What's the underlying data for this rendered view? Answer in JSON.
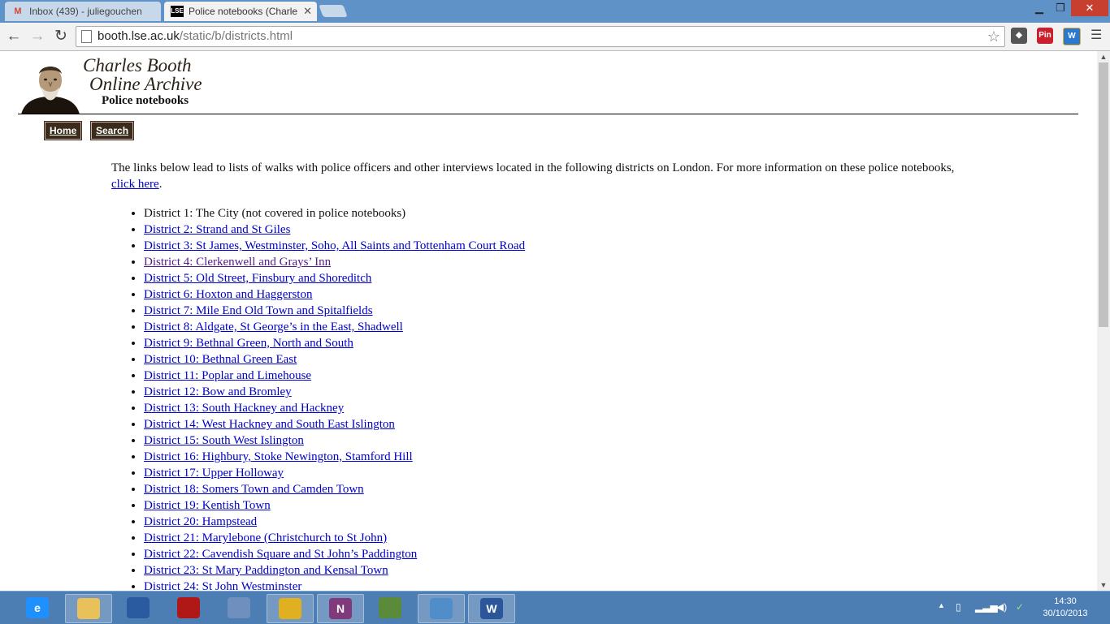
{
  "browser": {
    "tabs": [
      {
        "favicon": "gmail-icon",
        "title": "Inbox (439) - juliegouchen",
        "active": false
      },
      {
        "favicon": "lse-icon",
        "title": "Police notebooks (Charles",
        "active": true
      }
    ],
    "favicon_text": {
      "lse": "LSE",
      "gmail": "M"
    },
    "url_host": "booth.lse.ac.uk",
    "url_path": "/static/b/districts.html",
    "extensions": [
      {
        "name": "evernote-extension-icon",
        "label": ""
      },
      {
        "name": "pinterest-extension-icon",
        "label": "Pin"
      },
      {
        "name": "wikiwand-extension-icon",
        "label": "W"
      }
    ]
  },
  "site": {
    "title_line1": "Charles Booth",
    "title_line2": "Online Archive",
    "subtitle": "Police notebooks",
    "nav": {
      "home": "Home",
      "search": "Search"
    }
  },
  "intro": {
    "text": "The links below lead to lists of walks with police officers and other interviews located in the following districts on London. For more information on these police notebooks, ",
    "link": "click here",
    "end": "."
  },
  "districts": [
    {
      "label": "District 1: The City (not covered in police notebooks)",
      "link": false
    },
    {
      "label": "District 2: Strand and St Giles",
      "link": true
    },
    {
      "label": "District 3: St James, Westminster, Soho, All Saints and Tottenham Court Road",
      "link": true
    },
    {
      "label": "District 4: Clerkenwell and Grays’ Inn",
      "link": true,
      "visited": true
    },
    {
      "label": "District 5: Old Street, Finsbury and Shoreditch",
      "link": true
    },
    {
      "label": "District 6: Hoxton and Haggerston",
      "link": true
    },
    {
      "label": "District 7: Mile End Old Town and Spitalfields",
      "link": true
    },
    {
      "label": "District 8: Aldgate, St George’s in the East, Shadwell",
      "link": true
    },
    {
      "label": "District 9: Bethnal Green, North and South",
      "link": true
    },
    {
      "label": "District 10: Bethnal Green East",
      "link": true
    },
    {
      "label": "District 11: Poplar and Limehouse",
      "link": true
    },
    {
      "label": "District 12: Bow and Bromley",
      "link": true
    },
    {
      "label": "District 13: South Hackney and Hackney",
      "link": true
    },
    {
      "label": "District 14: West Hackney and South East Islington",
      "link": true
    },
    {
      "label": "District 15: South West Islington",
      "link": true
    },
    {
      "label": "District 16: Highbury, Stoke Newington, Stamford Hill",
      "link": true
    },
    {
      "label": "District 17: Upper Holloway",
      "link": true
    },
    {
      "label": "District 18: Somers Town and Camden Town",
      "link": true
    },
    {
      "label": "District 19: Kentish Town",
      "link": true
    },
    {
      "label": "District 20: Hampstead",
      "link": true
    },
    {
      "label": "District 21: Marylebone (Christchurch to St John)",
      "link": true
    },
    {
      "label": "District 22: Cavendish Square and St John’s Paddington",
      "link": true
    },
    {
      "label": "District 23: St Mary Paddington and Kensal Town",
      "link": true
    },
    {
      "label": "District 24: St John Westminster",
      "link": true
    }
  ],
  "taskbar": {
    "apps": [
      {
        "name": "internet-explorer-icon",
        "label": "e",
        "color": "#1e90ff",
        "active": false
      },
      {
        "name": "file-explorer-icon",
        "label": "",
        "color": "#e8c15a",
        "active": true
      },
      {
        "name": "remote-desktop-icon",
        "label": "",
        "color": "#2a5aa0",
        "active": false
      },
      {
        "name": "media-player-icon",
        "label": "",
        "color": "#b01818",
        "active": false
      },
      {
        "name": "messenger-icon",
        "label": "",
        "color": "#6f8fbf",
        "active": false
      },
      {
        "name": "chrome-icon",
        "label": "",
        "color": "#e0b020",
        "active": true
      },
      {
        "name": "onenote-icon",
        "label": "N",
        "color": "#80397b",
        "active": true
      },
      {
        "name": "evernote-icon",
        "label": "",
        "color": "#5a8a3a",
        "active": false
      },
      {
        "name": "photo-viewer-icon",
        "label": "",
        "color": "#4f8ec9",
        "active": true
      },
      {
        "name": "word-icon",
        "label": "W",
        "color": "#2b579a",
        "active": true
      }
    ],
    "time": "14:30",
    "date": "30/10/2013"
  }
}
